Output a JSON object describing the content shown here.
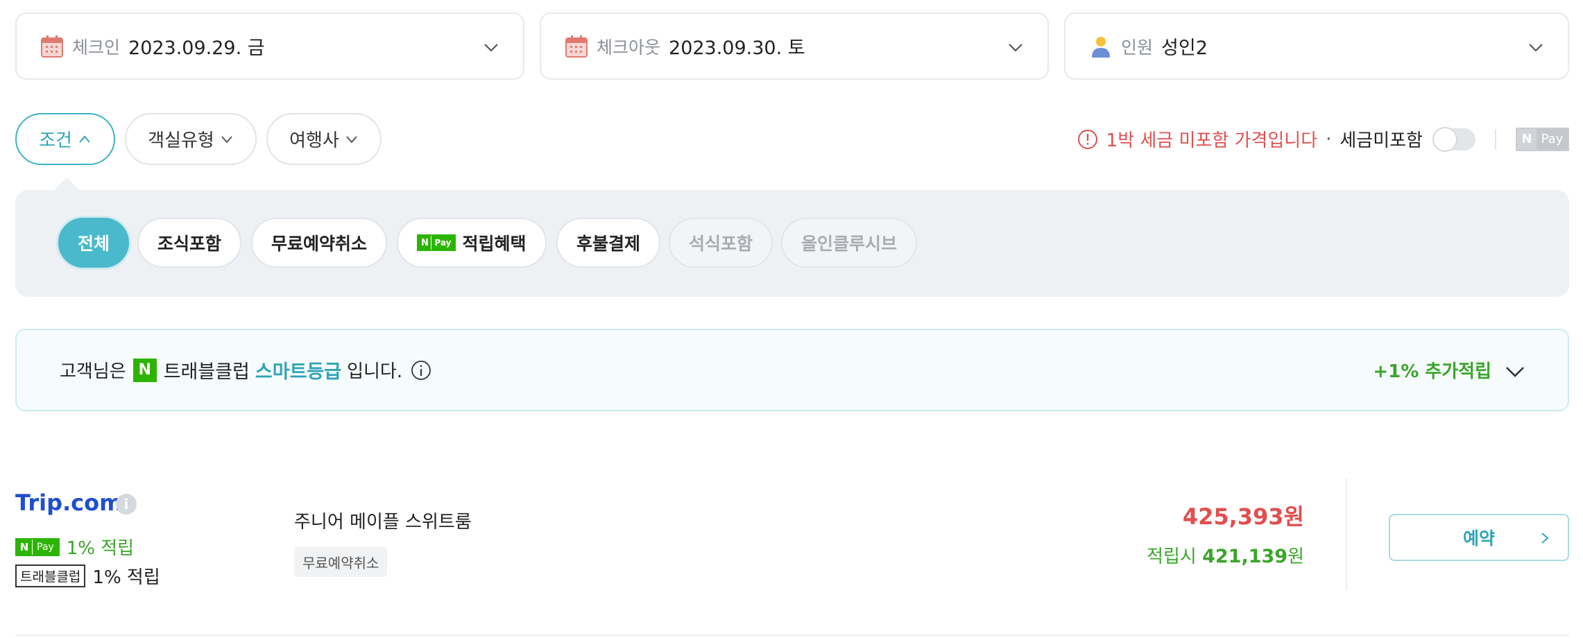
{
  "search": {
    "checkin": {
      "label": "체크인",
      "value": "2023.09.29. 금",
      "icon": "calendar-icon"
    },
    "checkout": {
      "label": "체크아웃",
      "value": "2023.09.30. 토",
      "icon": "calendar-icon"
    },
    "guests": {
      "label": "인원",
      "value": "성인2",
      "icon": "person-icon"
    }
  },
  "filters": {
    "condition": "조건",
    "room_type": "객실유형",
    "agency": "여행사"
  },
  "tax": {
    "notice": "1박 세금 미포함 가격입니다",
    "separator": "·",
    "toggle_label": "세금미포함",
    "toggle_on": false,
    "npay_n": "N",
    "npay_pay": "Pay"
  },
  "conditions": {
    "all": "전체",
    "breakfast": "조식포함",
    "free_cancel": "무료예약취소",
    "npay_n": "N",
    "npay_pay": "Pay",
    "points": "적립혜택",
    "postpay": "후불결제",
    "dinner": "석식포함",
    "all_inclusive": "올인클루시브"
  },
  "club_banner": {
    "prefix": "고객님은",
    "n": "N",
    "club": "트래블클럽",
    "grade": "스마트등급",
    "suffix": "입니다.",
    "bonus": "+1% 추가적립"
  },
  "offer": {
    "brand": "Trip.com",
    "brand_info": "i",
    "npay_n": "N",
    "npay_pay": "Pay",
    "npay_reward": "1% 적립",
    "club_badge": "트래블클럽",
    "club_reward": "1% 적립",
    "room_name": "주니어 메이플 스위트룸",
    "room_tag": "무료예약취소",
    "price": "425,393원",
    "reward_prefix": "적립시",
    "reward_price": "421,139",
    "reward_unit": "원",
    "book_label": "예약"
  },
  "colors": {
    "accent": "#3fb2c3",
    "warning": "#e24e4e",
    "green": "#3aa529",
    "npay_green": "#2db400",
    "brand_blue": "#1f4fd0"
  }
}
